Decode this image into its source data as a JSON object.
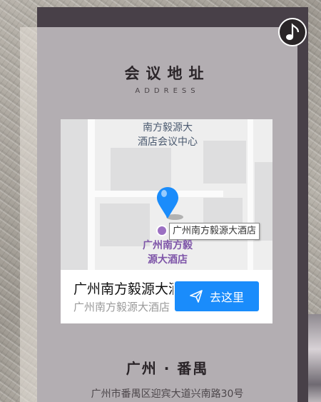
{
  "section": {
    "title": "会议地址",
    "subtitle": "ADDRESS"
  },
  "music": {
    "icon": "music-note-icon"
  },
  "map": {
    "top_label": "南方毅源大\n酒店会议中心",
    "poi_tag": "广州南方毅源大酒店",
    "poi_name": "广州南方毅\n源大酒店",
    "pin_color": "#1a8cfb",
    "poi_color": "#9b6fc2"
  },
  "info_card": {
    "name": "广州南方毅源大酒店",
    "address": "广州南方毅源大酒店",
    "go_label": "去这里",
    "go_color": "#1a8cfb"
  },
  "location": {
    "city": "广州 · 番禺",
    "street": "广州市番禺区迎宾大道兴南路30号"
  }
}
